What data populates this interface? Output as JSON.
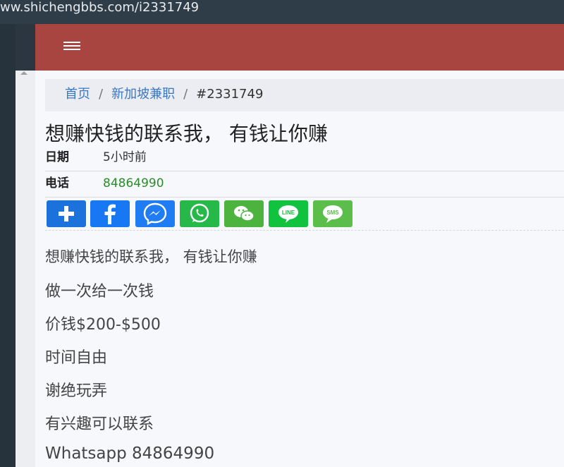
{
  "browser": {
    "url": "ww.shichengbbs.com/i2331749"
  },
  "header": {
    "menu_icon": "hamburger-menu-icon",
    "color": "#a94540"
  },
  "breadcrumb": {
    "home": "首页",
    "category": "新加坡兼职",
    "current": "#2331749",
    "link_color": "#3a78c3"
  },
  "post": {
    "title": "想赚快钱的联系我， 有钱让你赚",
    "date_label": "日期",
    "date_value": "5小时前",
    "phone_label": "电话",
    "phone_value": "84864990",
    "phone_color": "#2a8c2a"
  },
  "share_buttons": [
    {
      "icon": "plus-share-icon",
      "color": "#1c72dd"
    },
    {
      "icon": "facebook-icon",
      "color": "#1877f2"
    },
    {
      "icon": "messenger-icon",
      "color": "#1f7cf2"
    },
    {
      "icon": "whatsapp-icon",
      "color": "#27b84a"
    },
    {
      "icon": "wechat-icon",
      "color": "#4cb43e"
    },
    {
      "icon": "line-icon",
      "color": "#10c23e"
    },
    {
      "icon": "sms-icon",
      "color": "#5bbd4a"
    }
  ],
  "body_lines": [
    "想赚快钱的联系我， 有钱让你赚",
    "做一次给一次钱",
    "价钱$200-$500",
    "时间自由",
    "谢绝玩弄",
    "有兴趣可以联系",
    "Whatsapp 84864990"
  ]
}
